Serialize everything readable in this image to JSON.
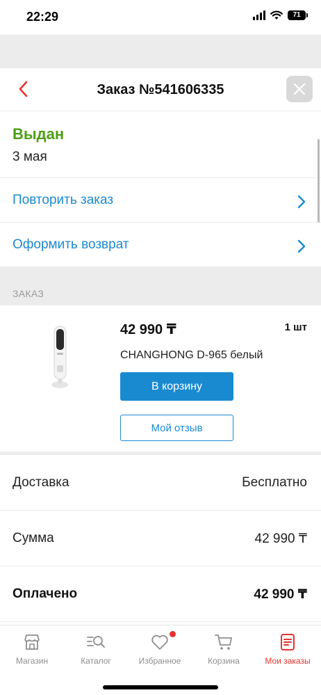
{
  "status_bar": {
    "time": "22:29",
    "battery": "71"
  },
  "header": {
    "title": "Заказ №541606335"
  },
  "order": {
    "status": "Выдан",
    "date": "3 мая"
  },
  "actions": [
    {
      "label": "Повторить заказ"
    },
    {
      "label": "Оформить возврат"
    }
  ],
  "section": {
    "title": "ЗАКАЗ"
  },
  "product": {
    "price": "42 990 ₸",
    "quantity": "1 шт",
    "name": "CHANGHONG D-965 белый",
    "cart_button": "В корзину",
    "review_button": "Мой отзыв"
  },
  "summary": [
    {
      "label": "Доставка",
      "value": "Бесплатно"
    },
    {
      "label": "Сумма",
      "value": "42 990 ₸"
    },
    {
      "label": "Оплачено",
      "value": "42 990 ₸"
    }
  ],
  "tabbar": {
    "items": [
      {
        "label": "Магазин",
        "icon": "shop-icon"
      },
      {
        "label": "Каталог",
        "icon": "catalog-search-icon"
      },
      {
        "label": "Избранное",
        "icon": "heart-icon"
      },
      {
        "label": "Корзина",
        "icon": "cart-icon"
      },
      {
        "label": "Мои заказы",
        "icon": "orders-icon"
      }
    ],
    "active_index": 4
  },
  "colors": {
    "accent_blue": "#1a8ad0",
    "status_green": "#4e9e16",
    "brand_red": "#e5322d"
  }
}
